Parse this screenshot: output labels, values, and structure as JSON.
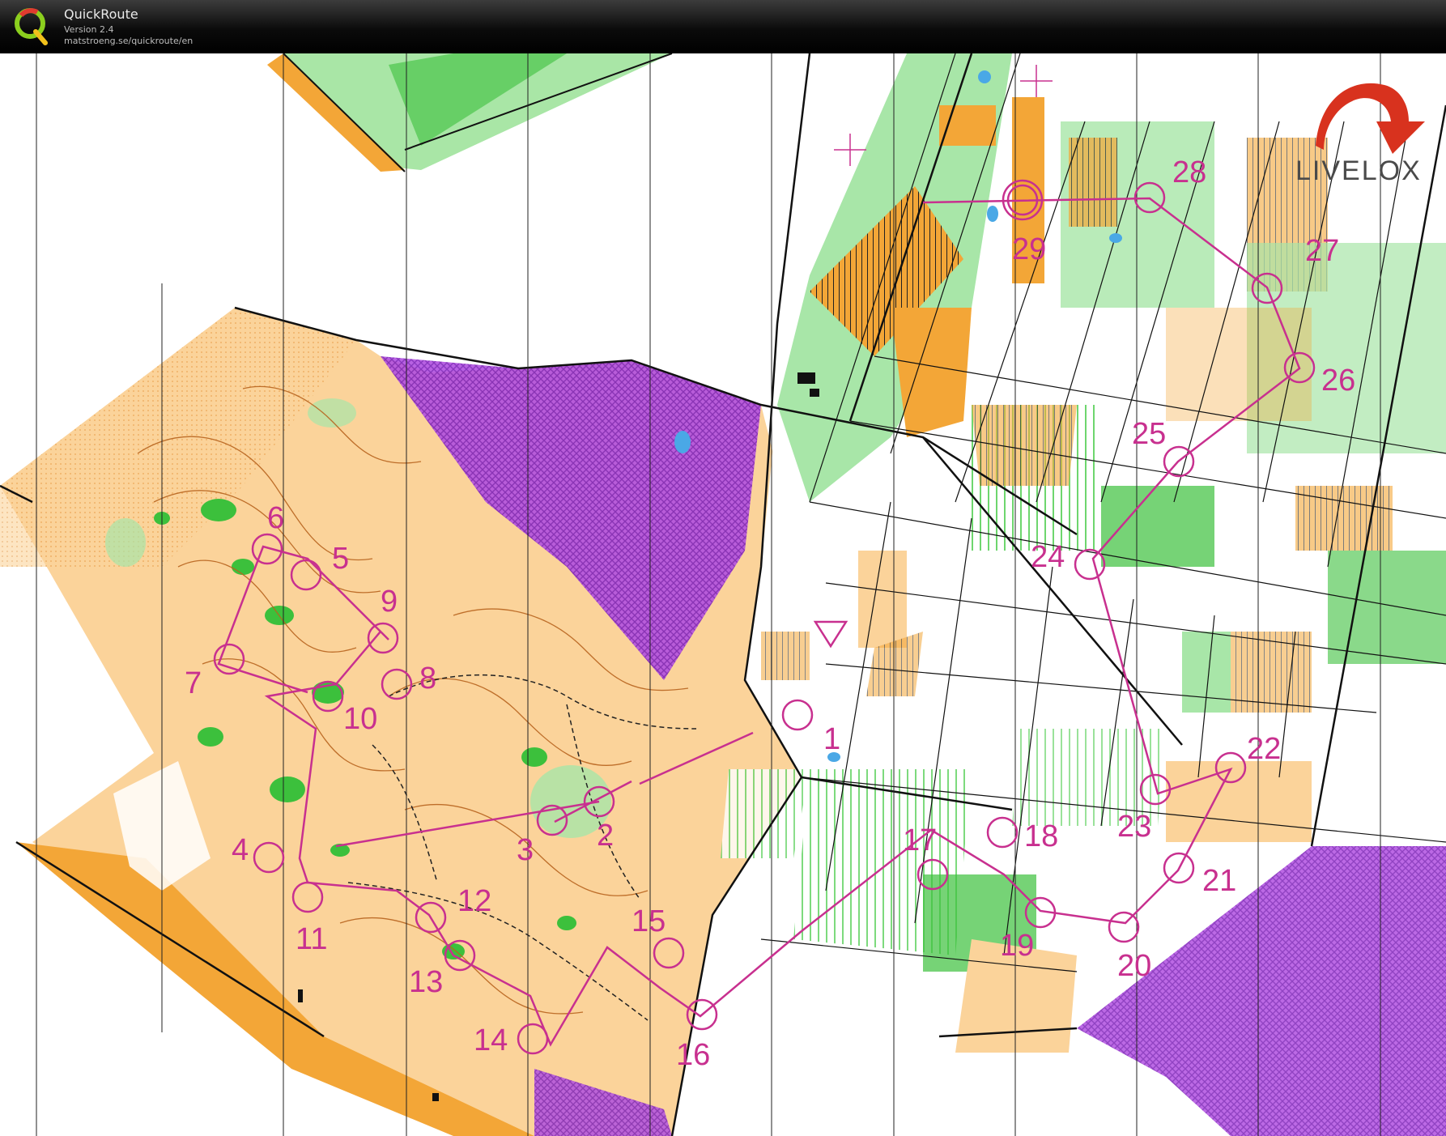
{
  "app": {
    "title": "QuickRoute",
    "version": "Version 2.4",
    "url": "matstroeng.se/quickroute/en"
  },
  "brand": {
    "watermark": "LIVELOX"
  },
  "colors": {
    "course": "#c8308f",
    "open_land": "#fbd39a",
    "rough_open": "#f6c37f",
    "forest_green": "#3cc03c",
    "light_green": "#a8e6a8",
    "out_of_bounds": "#9b3cd8",
    "contour": "#b8641e",
    "cultivated": "#f3a637"
  },
  "course": {
    "start_label": "",
    "finish_label": "29",
    "controls": [
      "1",
      "2",
      "3",
      "4",
      "5",
      "6",
      "7",
      "8",
      "9",
      "10",
      "11",
      "12",
      "13",
      "14",
      "15",
      "16",
      "17",
      "18",
      "19",
      "20",
      "21",
      "22",
      "23",
      "24",
      "25",
      "26",
      "27",
      "28",
      "29"
    ]
  }
}
